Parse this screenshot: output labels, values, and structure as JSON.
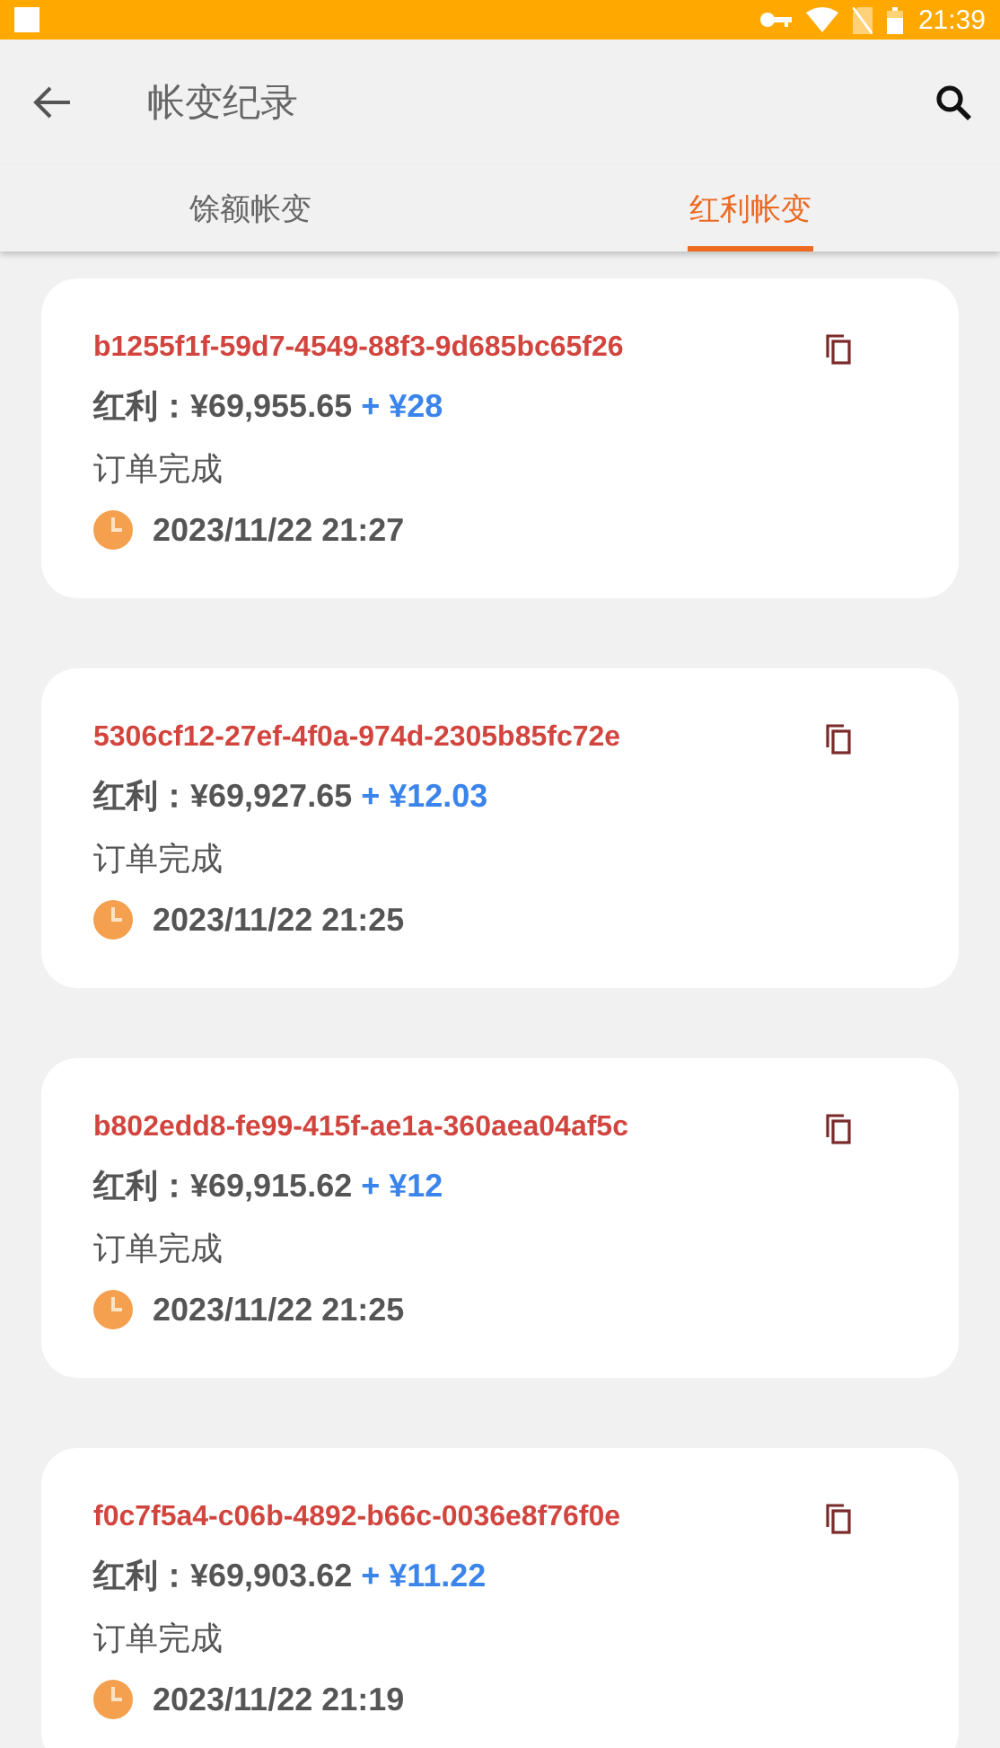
{
  "status_bar": {
    "time": "21:39"
  },
  "app_bar": {
    "title": "帐变纪录"
  },
  "tabs": [
    {
      "label": "馀额帐变",
      "selected": false
    },
    {
      "label": "红利帐变",
      "selected": true
    }
  ],
  "records": [
    {
      "id": "b1255f1f-59d7-4549-88f3-9d685bc65f26",
      "balance": "红利：¥69,955.65",
      "change": "+ ¥28",
      "status": "订单完成",
      "time": "2023/11/22 21:27"
    },
    {
      "id": "5306cf12-27ef-4f0a-974d-2305b85fc72e",
      "balance": "红利：¥69,927.65",
      "change": "+ ¥12.03",
      "status": "订单完成",
      "time": "2023/11/22 21:25"
    },
    {
      "id": "b802edd8-fe99-415f-ae1a-360aea04af5c",
      "balance": "红利：¥69,915.62",
      "change": "+ ¥12",
      "status": "订单完成",
      "time": "2023/11/22 21:25"
    },
    {
      "id": "f0c7f5a4-c06b-4892-b66c-0036e8f76f0e",
      "balance": "红利：¥69,903.62",
      "change": "+ ¥11.22",
      "status": "订单完成",
      "time": "2023/11/22 21:19"
    }
  ]
}
